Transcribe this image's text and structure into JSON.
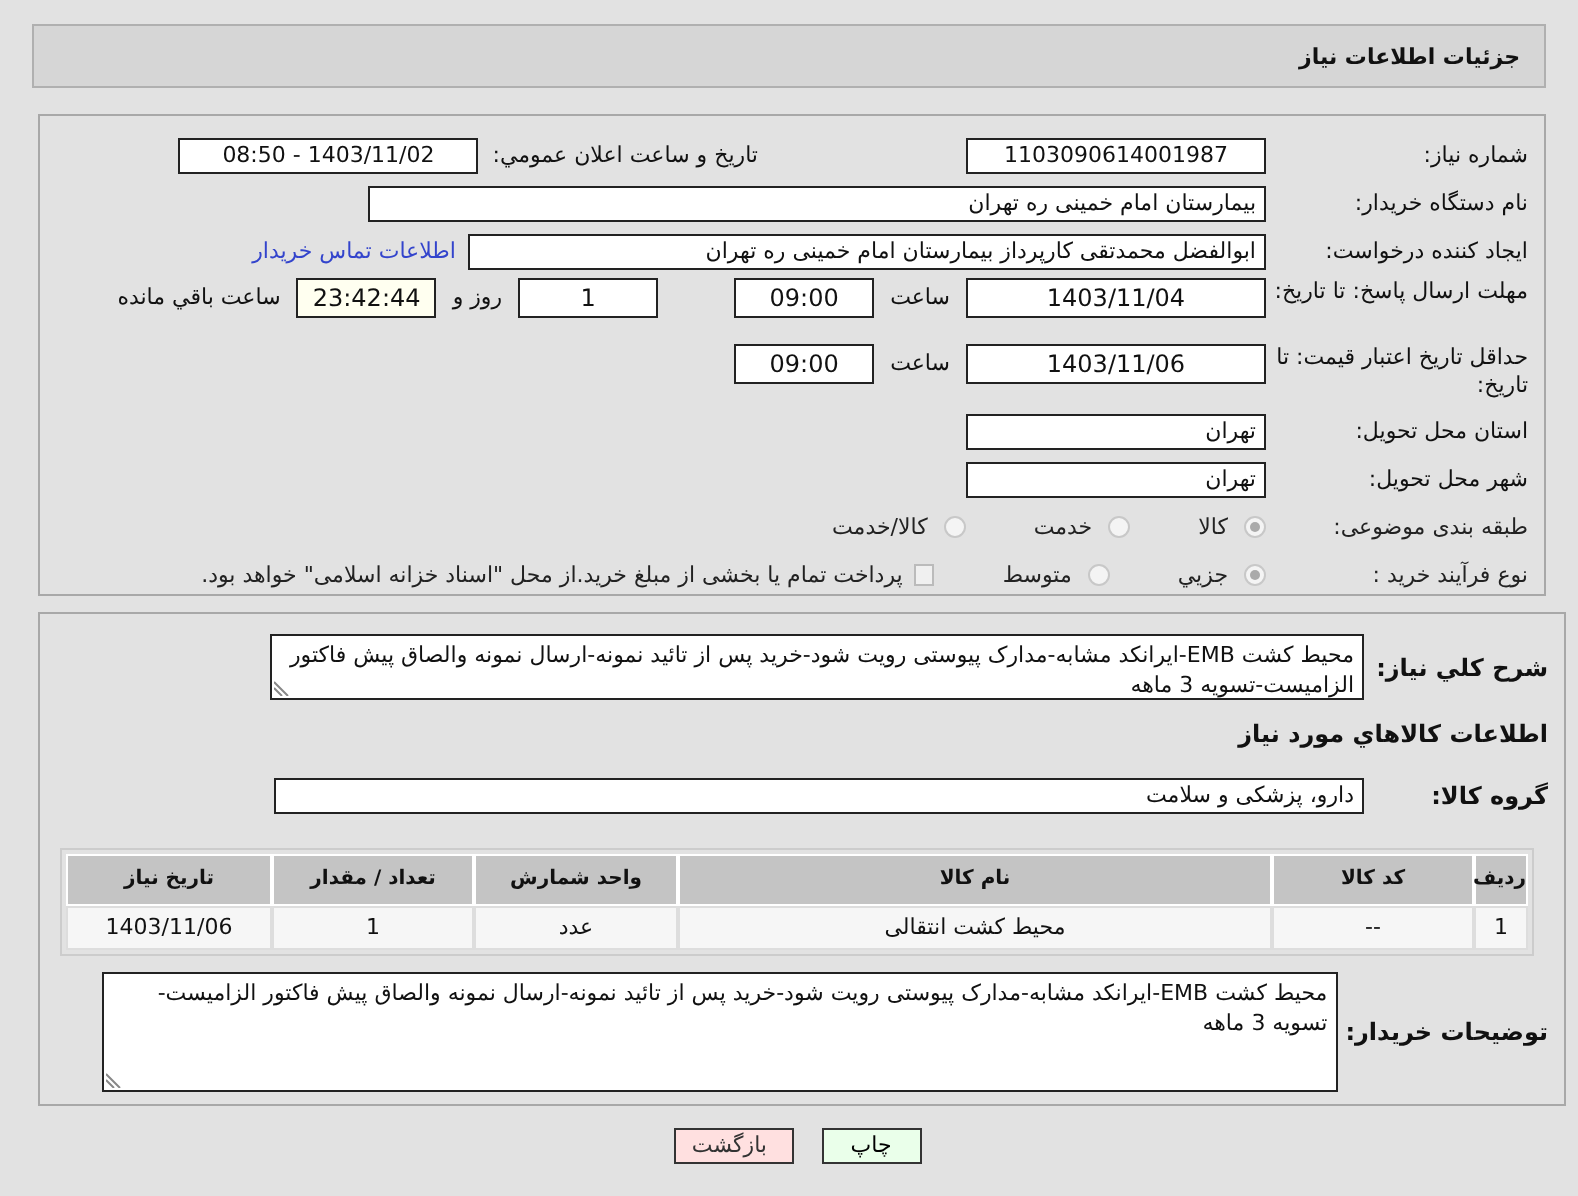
{
  "header": {
    "title": "جزئیات اطلاعات نیاز"
  },
  "need_number": {
    "label": "شماره نیاز:",
    "value": "1103090614001987"
  },
  "announce": {
    "label": "تاریخ و ساعت اعلان عمومي:",
    "value": "1403/11/02 - 08:50"
  },
  "buyer_org": {
    "label": "نام دستگاه خریدار:",
    "value": "بیمارستان امام خمینی ره  تهران"
  },
  "requester": {
    "label": "ایجاد کننده درخواست:",
    "value": "ابوالفضل محمدتقی کارپرداز بیمارستان امام خمینی ره  تهران",
    "link": "اطلاعات تماس خریدار"
  },
  "reply_deadline": {
    "label": "مهلت ارسال پاسخ: تا تاریخ:",
    "date": "1403/11/04",
    "time_label": "ساعت",
    "time": "09:00",
    "days": "1",
    "days_label": "روز و",
    "remaining": "23:42:44",
    "remaining_label": "ساعت باقي مانده"
  },
  "price_validity": {
    "label": "حداقل تاریخ اعتبار قیمت: تا تاریخ:",
    "date": "1403/11/06",
    "time_label": "ساعت",
    "time": "09:00"
  },
  "province": {
    "label": "استان محل تحویل:",
    "value": "تهران"
  },
  "city": {
    "label": "شهر محل تحویل:",
    "value": "تهران"
  },
  "category": {
    "label": "طبقه بندی موضوعی:",
    "options": [
      {
        "label": "کالا",
        "selected": true
      },
      {
        "label": "خدمت",
        "selected": false
      },
      {
        "label": "کالا/خدمت",
        "selected": false
      }
    ]
  },
  "purchase_type": {
    "label": "نوع فرآیند خرید :",
    "options": [
      {
        "label": "جزیي",
        "selected": true
      },
      {
        "label": "متوسط",
        "selected": false
      }
    ],
    "payment": {
      "label": "پرداخت تمام یا بخشی از مبلغ خرید.از محل \"اسناد خزانه اسلامی\" خواهد بود.",
      "checked": false
    }
  },
  "description": {
    "label": "شرح کلي نیاز:",
    "value": "محیط کشت EMB-ایرانکد مشابه-مدارک پیوستی رویت شود-خرید پس از تائید نمونه-ارسال نمونه والصاق پیش فاکتور الزامیست-تسویه 3 ماهه"
  },
  "goods_heading": "اطلاعات کالاهاي مورد نیاز",
  "goods_group": {
    "label": "گروه کالا:",
    "value": "دارو، پزشکی و سلامت"
  },
  "table": {
    "columns": [
      "ردیف",
      "کد کالا",
      "نام کالا",
      "واحد شمارش",
      "تعداد / مقدار",
      "تاریخ نیاز"
    ],
    "rows": [
      [
        "1",
        "--",
        "محیط کشت انتقالی",
        "عدد",
        "1",
        "1403/11/06"
      ]
    ]
  },
  "buyer_notes": {
    "label": "توضیحات خریدار:",
    "value": "محیط کشت EMB-ایرانکد مشابه-مدارک پیوستی رویت شود-خرید پس از تائید نمونه-ارسال نمونه والصاق پیش فاکتور الزامیست-تسویه 3 ماهه"
  },
  "buttons": [
    {
      "label": "چاپ",
      "kind": "print"
    },
    {
      "label": "بازگشت",
      "kind": "back"
    }
  ]
}
